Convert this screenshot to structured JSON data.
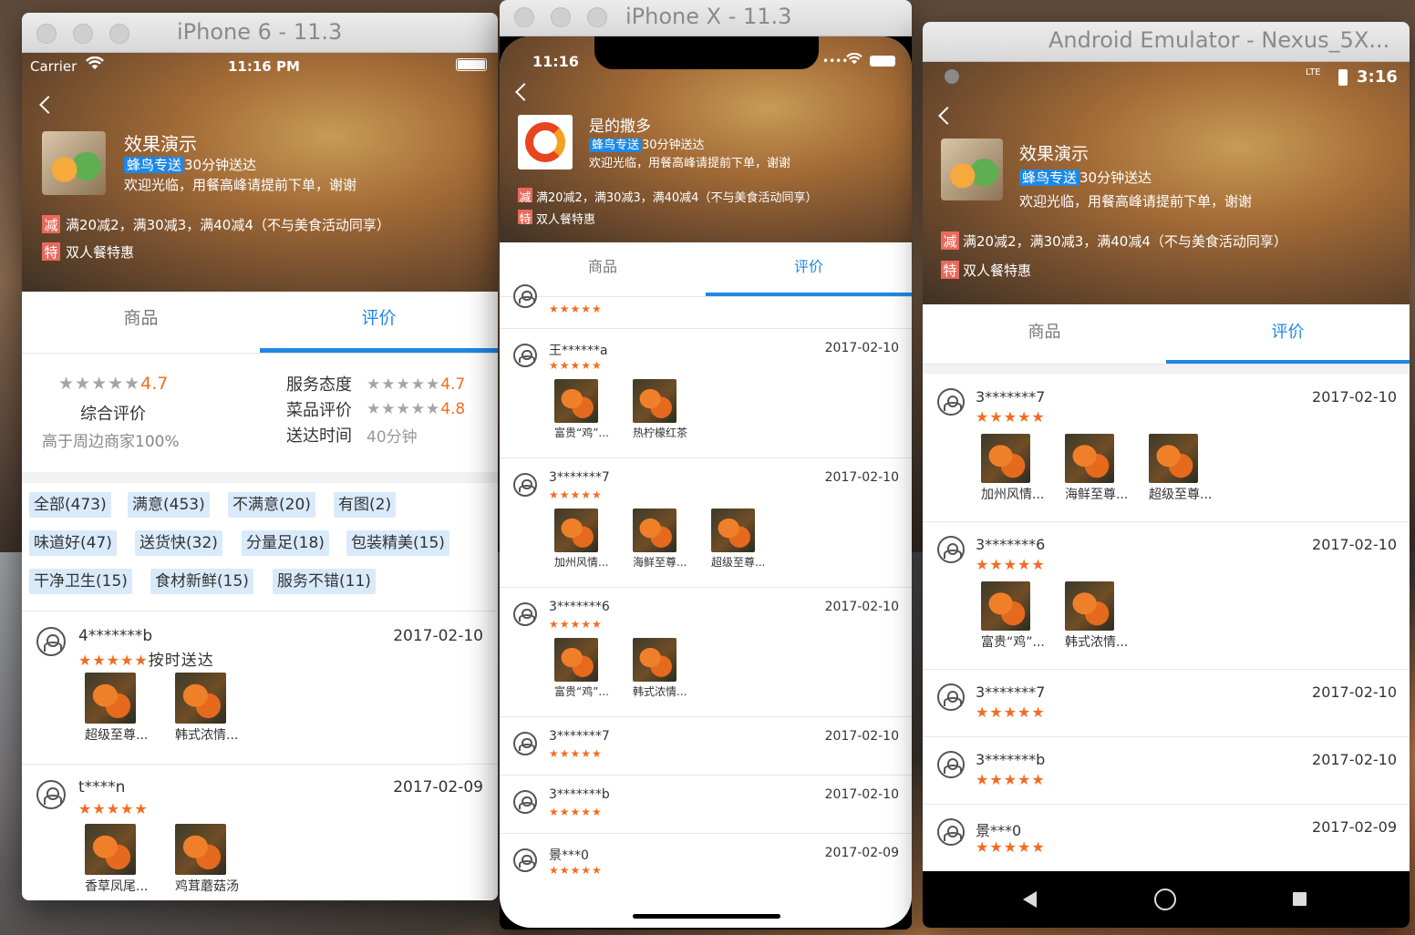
{
  "windows": {
    "iphone6": {
      "title": "iPhone 6 - 11.3"
    },
    "iphonex": {
      "title": "iPhone X - 11.3"
    },
    "android": {
      "title": "Android Emulator - Nexus_5X..."
    }
  },
  "status": {
    "iphone6": {
      "carrier": "Carrier",
      "time": "11:16 PM"
    },
    "iphonex": {
      "time": "11:16"
    },
    "android": {
      "network": "LTE",
      "time": "3:16"
    }
  },
  "shop": {
    "name": "效果演示",
    "name_x": "是的撒多",
    "delivery_tag": "蜂鸟专送",
    "delivery_time": "30分钟送达",
    "notice": "欢迎光临，用餐高峰请提前下单，谢谢",
    "promo_badge": "减",
    "promo_text": "满20减2，满30减3，满40减4（不与美食活动同享）",
    "special_badge": "特",
    "special_text": "双人餐特惠"
  },
  "tabs": [
    "商品",
    "评价"
  ],
  "rating_summary": {
    "overall_stars": "★★★★★",
    "overall_score": "4.7",
    "overall_label": "综合评价",
    "compare_text": "高于周边商家100%",
    "service_label": "服务态度",
    "service_stars": "★★★★★",
    "service_score": "4.7",
    "food_label": "菜品评价",
    "food_stars": "★★★★★",
    "food_score": "4.8",
    "delivery_label": "送达时间",
    "delivery_value": "40分钟"
  },
  "filter_tags": [
    "全部(473)",
    "满意(453)",
    "不满意(20)",
    "有图(2)",
    "味道好(47)",
    "送货快(32)",
    "分量足(18)",
    "包装精美(15)",
    "干净卫生(15)",
    "食材新鲜(15)",
    "服务不错(11)"
  ],
  "stars5": "★★★★★",
  "reviews_iphone6": [
    {
      "user": "4*******b",
      "date": "2017-02-10",
      "text": "按时送达",
      "foods": [
        "超级至尊...",
        "韩式浓情..."
      ]
    },
    {
      "user": "t****n",
      "date": "2017-02-09",
      "text": "",
      "foods": [
        "香草凤尾...",
        "鸡茸蘑菇汤"
      ]
    }
  ],
  "reviews_iphonex": [
    {
      "user": "王******a",
      "date": "2017-02-10",
      "foods": [
        "富贵“鸡”...",
        "热柠檬红茶"
      ]
    },
    {
      "user": "3*******7",
      "date": "2017-02-10",
      "foods": [
        "加州风情...",
        "海鲜至尊...",
        "超级至尊..."
      ]
    },
    {
      "user": "3*******6",
      "date": "2017-02-10",
      "foods": [
        "富贵“鸡”...",
        "韩式浓情..."
      ]
    },
    {
      "user": "3*******7",
      "date": "2017-02-10",
      "foods": []
    },
    {
      "user": "3*******b",
      "date": "2017-02-10",
      "foods": []
    },
    {
      "user": "景***0",
      "date": "2017-02-09",
      "foods": []
    }
  ],
  "reviews_android": [
    {
      "user": "3*******7",
      "date": "2017-02-10",
      "foods": [
        "加州风情...",
        "海鲜至尊...",
        "超级至尊..."
      ]
    },
    {
      "user": "3*******6",
      "date": "2017-02-10",
      "foods": [
        "富贵“鸡”...",
        "韩式浓情..."
      ]
    },
    {
      "user": "3*******7",
      "date": "2017-02-10",
      "foods": []
    },
    {
      "user": "3*******b",
      "date": "2017-02-10",
      "foods": []
    },
    {
      "user": "景***0",
      "date": "2017-02-09",
      "foods": []
    }
  ],
  "colors": {
    "accent": "#1e88e5",
    "star": "#f36c21",
    "promo": "#e86a5c",
    "tag_bg": "#d9eafb"
  }
}
